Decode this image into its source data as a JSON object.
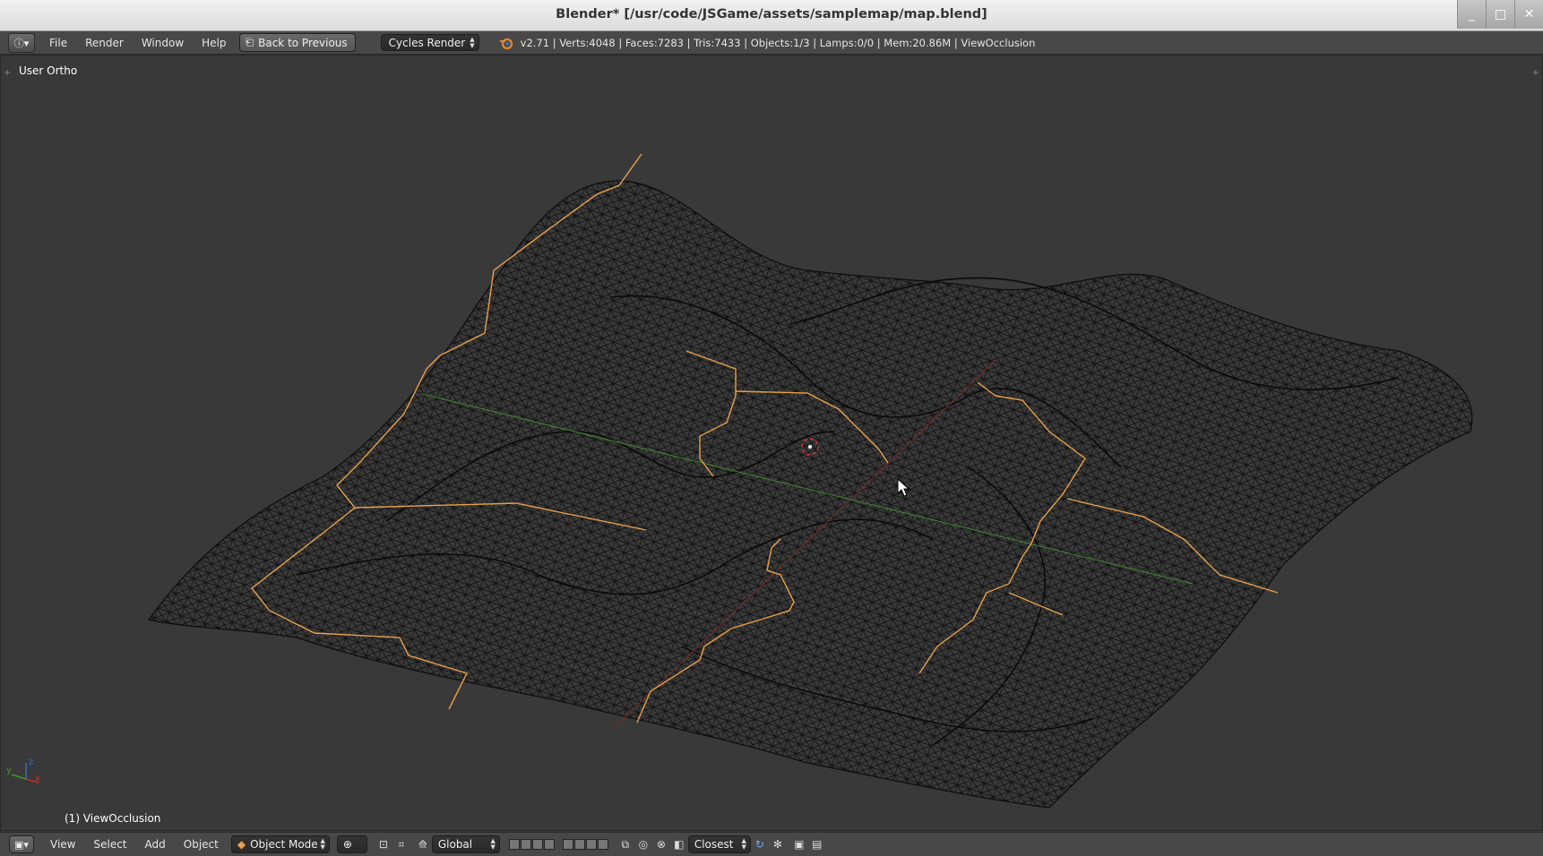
{
  "window": {
    "title": "Blender* [/usr/code/JSGame/assets/samplemap/map.blend]",
    "controls": [
      "_",
      "□",
      "✕"
    ]
  },
  "infobar": {
    "menus": [
      "File",
      "Render",
      "Window",
      "Help"
    ],
    "back_label": "Back to Previous",
    "render_engine": "Cycles Render",
    "stats": "v2.71 | Verts:4048 | Faces:7283 | Tris:7433 | Objects:1/3 | Lamps:0/0 | Mem:20.86M | ViewOcclusion"
  },
  "viewport": {
    "view_label": "User Ortho",
    "object_label": "(1) ViewOcclusion",
    "axis_labels": {
      "x": "x",
      "y": "y",
      "z": "z"
    },
    "colors": {
      "background": "#393939",
      "wire": "#0b0b0b",
      "path": "#e8a04a",
      "x_axis": "#8a2b2b",
      "y_axis": "#3f8a2f",
      "grid": "#4a4a4a"
    }
  },
  "bottombar": {
    "menus": [
      "View",
      "Select",
      "Add",
      "Object"
    ],
    "mode": "Object Mode",
    "orientation": "Global",
    "snap_target": "Closest"
  }
}
